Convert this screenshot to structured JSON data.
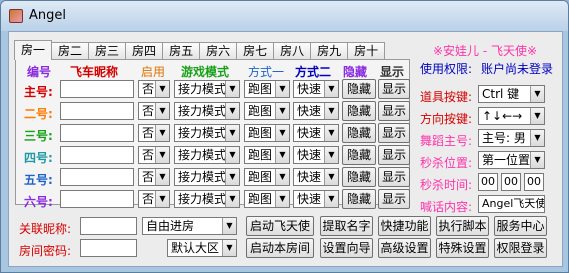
{
  "window": {
    "title": "Angel"
  },
  "tabs": [
    "房一",
    "房二",
    "房三",
    "房四",
    "房五",
    "房六",
    "房七",
    "房八",
    "房九",
    "房十"
  ],
  "headers": {
    "id": "编号",
    "nick": "飞车昵称",
    "enable": "启用",
    "mode": "游戏模式",
    "way1": "方式一",
    "way2": "方式二",
    "hide": "隐藏",
    "show": "显示"
  },
  "rows": [
    {
      "label": "主号:",
      "label_color": "#d60000",
      "enable": "否",
      "mode": "接力模式",
      "way1": "跑图",
      "way2": "快速",
      "hide": "隐藏",
      "show": "显示"
    },
    {
      "label": "二号:",
      "label_color": "#ff7a00",
      "enable": "否",
      "mode": "接力模式",
      "way1": "跑图",
      "way2": "快速",
      "hide": "隐藏",
      "show": "显示"
    },
    {
      "label": "三号:",
      "label_color": "#18a018",
      "enable": "否",
      "mode": "接力模式",
      "way1": "跑图",
      "way2": "快速",
      "hide": "隐藏",
      "show": "显示"
    },
    {
      "label": "四号:",
      "label_color": "#1e9aa6",
      "enable": "否",
      "mode": "接力模式",
      "way1": "跑图",
      "way2": "快速",
      "hide": "隐藏",
      "show": "显示"
    },
    {
      "label": "五号:",
      "label_color": "#1e62c8",
      "enable": "否",
      "mode": "接力模式",
      "way1": "跑图",
      "way2": "快速",
      "hide": "隐藏",
      "show": "显示"
    },
    {
      "label": "六号:",
      "label_color": "#8a2be2",
      "enable": "否",
      "mode": "接力模式",
      "way1": "跑图",
      "way2": "快速",
      "hide": "隐藏",
      "show": "显示"
    }
  ],
  "right": {
    "brand": "※安娃儿 - 飞天使※",
    "perm_label": "使用权限:",
    "perm_value": "账户尚未登录",
    "prop_key_label": "道具按键:",
    "prop_key_value": "Ctrl  键",
    "dir_key_label": "方向按键:",
    "dir_key_value": "↑↓←→",
    "dance_label": "舞蹈主号:",
    "dance_value": "主号: 男",
    "kill_pos_label": "秒杀位置:",
    "kill_pos_value": "第一位置",
    "kill_time_label": "秒杀时间:",
    "kill_time_h": "00",
    "kill_time_m": "00",
    "kill_time_s": "00",
    "shout_label": "喊话内容:",
    "shout_value": "Angel飞天使"
  },
  "bottom": {
    "link_nick_label": "关联昵称:",
    "room_pwd_label": "房间密码:",
    "auto_room": "自由进房",
    "default_zone": "默认大区",
    "btn_start_angel": "启动飞天使",
    "btn_start_room": "启动本房间",
    "btn_get_name": "提取名字",
    "btn_setup_wizard": "设置向导",
    "btn_shortcut": "快捷功能",
    "btn_advanced": "高级设置",
    "btn_run_script": "执行脚本",
    "btn_special": "特殊设置",
    "btn_service": "服务中心",
    "btn_login": "权限登录"
  }
}
